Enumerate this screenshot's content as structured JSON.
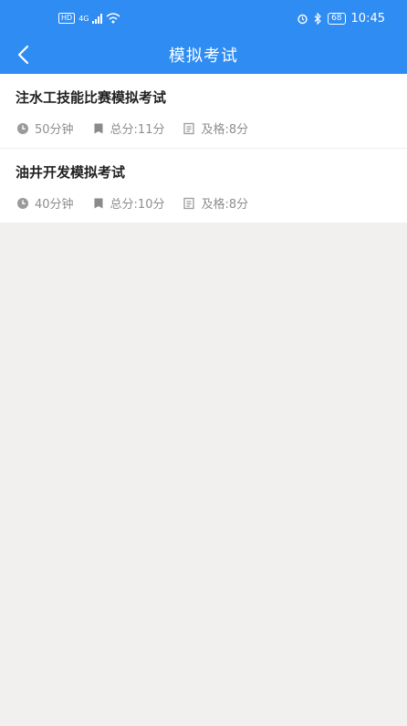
{
  "status_bar": {
    "hd": "HD",
    "network": "4G",
    "battery": "68",
    "time": "10:45"
  },
  "header": {
    "title": "模拟考试",
    "bg_color": "#2f8cf2"
  },
  "exams": [
    {
      "title": "注水工技能比赛模拟考试",
      "duration": "50分钟",
      "total": "总分:11分",
      "pass": "及格:8分"
    },
    {
      "title": "油井开发模拟考试",
      "duration": "40分钟",
      "total": "总分:10分",
      "pass": "及格:8分"
    }
  ]
}
